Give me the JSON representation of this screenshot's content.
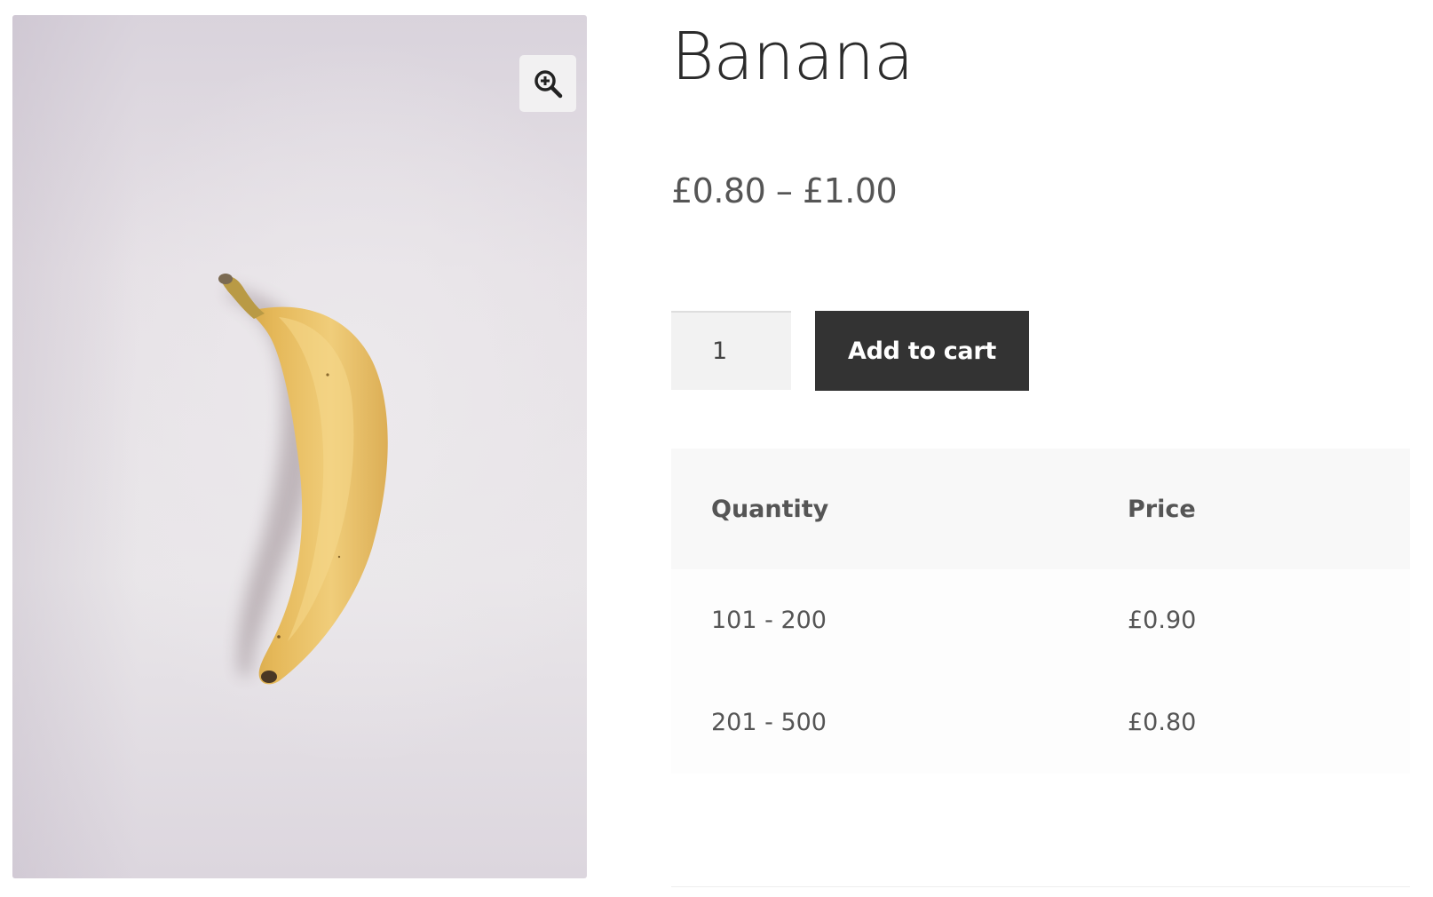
{
  "product": {
    "title": "Banana",
    "price_range": "£0.80 – £1.00",
    "image_alt": "Banana"
  },
  "gallery": {
    "zoom_icon": "zoom-in-icon"
  },
  "cart": {
    "quantity_value": "1",
    "add_to_cart_label": "Add to cart"
  },
  "pricing_table": {
    "headers": {
      "quantity": "Quantity",
      "price": "Price"
    },
    "rows": [
      {
        "quantity": "101 - 200",
        "price": "£0.90"
      },
      {
        "quantity": "201 - 500",
        "price": "£0.80"
      }
    ]
  },
  "colors": {
    "button_bg": "#333333",
    "button_text": "#ffffff",
    "banana_yellow": "#ecc66a",
    "table_header_bg": "#f8f8f8"
  }
}
